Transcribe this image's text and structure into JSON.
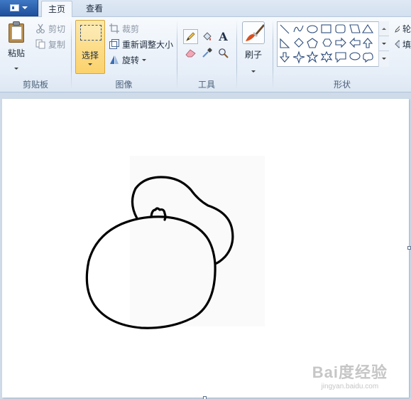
{
  "tabs": {
    "home": "主页",
    "view": "查看"
  },
  "ribbon": {
    "clipboard": {
      "title": "剪贴板",
      "paste": "粘贴",
      "cut": "剪切",
      "copy": "复制"
    },
    "image": {
      "title": "图像",
      "select": "选择",
      "crop": "裁剪",
      "resize": "重新调整大小",
      "rotate": "旋转"
    },
    "tools": {
      "title": "工具",
      "text_glyph": "A"
    },
    "brushes": {
      "label": "刷子"
    },
    "shapes": {
      "title": "形状",
      "outline_partial": "轮",
      "fill_partial": "填"
    }
  },
  "watermark": {
    "brand": "Bai度经验",
    "url": "jingyan.baidu.com"
  },
  "colors": {
    "ribbon_bg": "#e6eef8",
    "workspace_bg": "#cfdbe9",
    "selected_button": "#fbd26c",
    "app_menu": "#2e64b0"
  }
}
